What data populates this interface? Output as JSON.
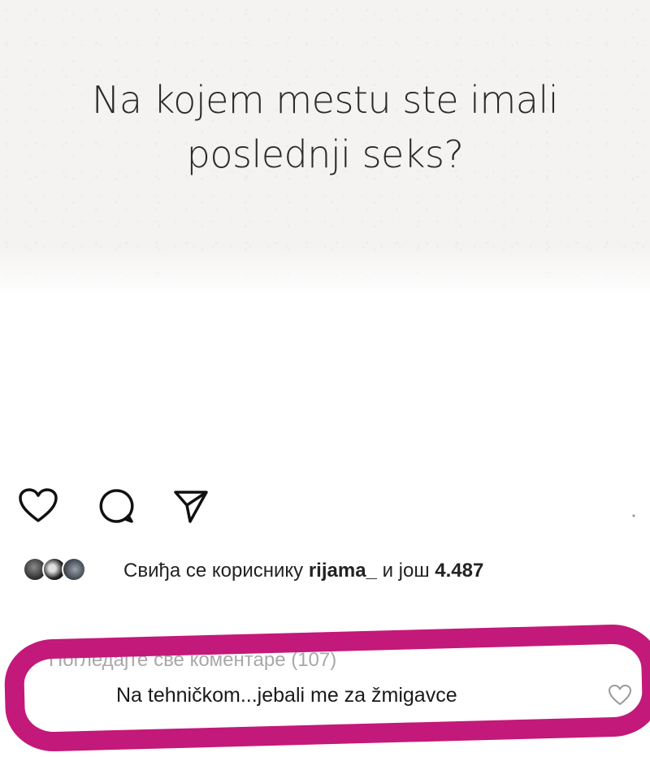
{
  "post": {
    "quote_line1": "Na kojem mestu ste imali",
    "quote_line2": "poslednji seks?"
  },
  "actions": {
    "like_icon": "heart-outline-icon",
    "comment_icon": "comment-bubble-icon",
    "share_icon": "send-paper-plane-icon"
  },
  "likes": {
    "prefix": "Свиђа се кориснику",
    "username": "rijama_",
    "connector": "и још",
    "count": "4.487"
  },
  "comments": {
    "view_all_partial": "Погледајте све коментаре (107)",
    "top_comment": "Na tehničkom...jebali me za žmigavce"
  },
  "colors": {
    "highlight": "#c2197a",
    "image_background": "#f4f3f1"
  }
}
